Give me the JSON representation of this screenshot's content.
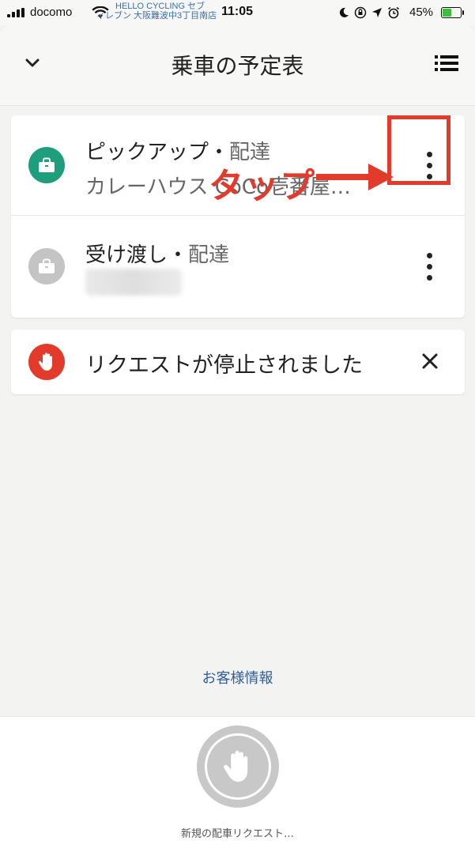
{
  "status_bar": {
    "carrier": "docomo",
    "promo_line1": "HELLO CYCLING セブ",
    "promo_line2": "ィレブン 大阪難波中3丁目南店",
    "time": "11:05",
    "battery_percent": "45%",
    "battery_level": 0.45,
    "icons": [
      "moon-icon",
      "orientation-lock-icon",
      "location-arrow-icon",
      "alarm-icon",
      "battery-charging-icon"
    ]
  },
  "header": {
    "title": "乗車の予定表",
    "left_icon": "chevron-down-icon",
    "right_icon": "list-icon"
  },
  "stops": [
    {
      "title": "ピックアップ・",
      "title_sub": "配達",
      "subtitle": "カレーハウス CoCo壱番屋…",
      "icon": "bag-icon",
      "icon_color": "#1f9e7e"
    },
    {
      "title": "受け渡し・",
      "title_sub": "配達",
      "subtitle": "",
      "icon": "bag-icon",
      "icon_color": "#c4c4c4"
    }
  ],
  "annotation": {
    "label": "タップ",
    "color": "#e23a2b"
  },
  "request_banner": {
    "text": "リクエストが停止されました",
    "icon": "hand-stop-icon",
    "icon_color": "#e23a2b",
    "close_icon": "close-icon"
  },
  "customer_info_link": "お客様情報",
  "bottom": {
    "button_icon": "hand-icon",
    "label": "新規の配車リクエスト…"
  }
}
